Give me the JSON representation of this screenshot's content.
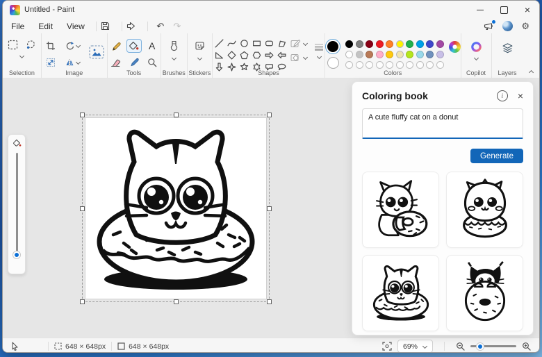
{
  "window": {
    "title": "Untitled - Paint",
    "close_glyph": "×"
  },
  "menu": {
    "file": "File",
    "edit": "Edit",
    "view": "View"
  },
  "quick_actions": {
    "undo_glyph": "↶",
    "redo_glyph": "↷"
  },
  "system_icons": {
    "gear_glyph": "⚙"
  },
  "ribbon": {
    "selection_label": "Selection",
    "image_label": "Image",
    "tools_label": "Tools",
    "brushes_label": "Brushes",
    "stickers_label": "Stickers",
    "shapes_label": "Shapes",
    "colors_label": "Colors",
    "copilot_label": "Copilot",
    "layers_label": "Layers",
    "text_tool_glyph": "A"
  },
  "palette": {
    "selected_color": "#000000",
    "secondary_color": "#ffffff",
    "row1": [
      "#000000",
      "#7f7f7f",
      "#880015",
      "#ed1c24",
      "#ff7f27",
      "#fff200",
      "#22b14c",
      "#00a2e8",
      "#3f48cc",
      "#a349a4"
    ],
    "row2": [
      "#ffffff",
      "#c3c3c3",
      "#b97a57",
      "#ffaec9",
      "#ffc90e",
      "#efe4b0",
      "#b5e61d",
      "#99d9ea",
      "#7092be",
      "#c8bfe7"
    ],
    "empty_slot_count": 10
  },
  "coloring_book": {
    "title": "Coloring book",
    "prompt": "A cute fluffy cat on a donut",
    "generate_label": "Generate",
    "info_glyph": "i",
    "close_glyph": "×"
  },
  "statusbar": {
    "selection_size": "648 × 648px",
    "canvas_size": "648 × 648px",
    "zoom_level": "69%"
  },
  "theme": {
    "accent": "#1266b8"
  }
}
